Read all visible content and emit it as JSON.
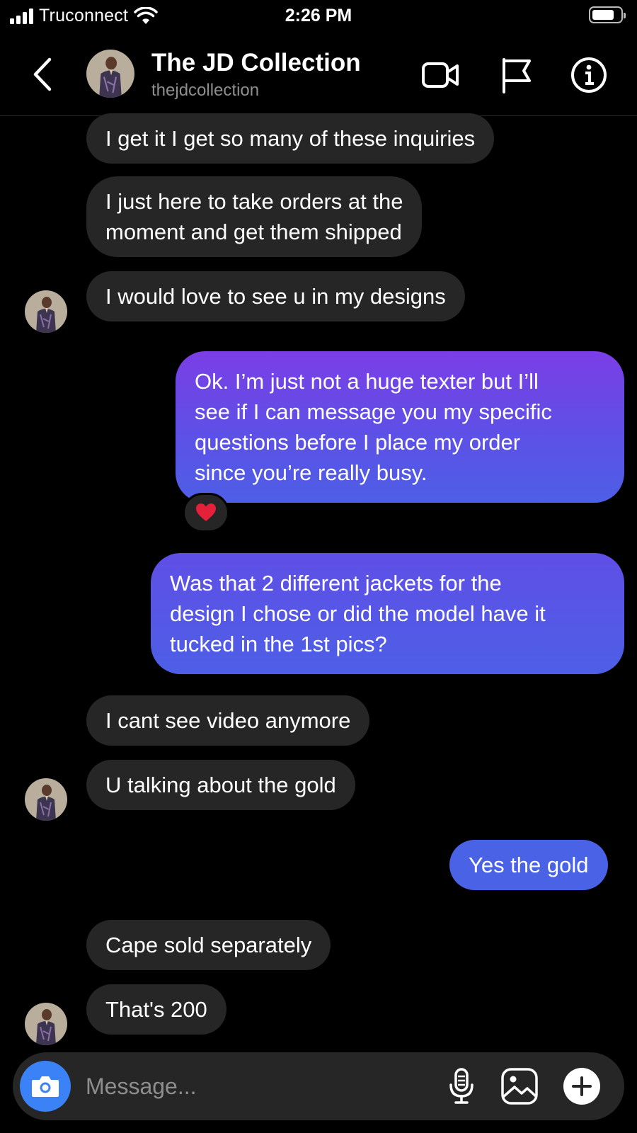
{
  "status_bar": {
    "carrier": "Truconnect",
    "time": "2:26 PM"
  },
  "header": {
    "title": "The JD Collection",
    "username": "thejdcollection",
    "icons": [
      "back-chevron-icon",
      "video-camera-icon",
      "flag-icon",
      "info-icon"
    ]
  },
  "messages": [
    {
      "side": "received",
      "text": "I get it I get so many of these inquiries"
    },
    {
      "side": "received",
      "text_lines": [
        "I just here to take orders at the",
        "moment and get them shipped"
      ]
    },
    {
      "side": "received",
      "text": "I would love to see u in my designs"
    },
    {
      "side": "sent",
      "text_lines": [
        "Ok. I’m just not a huge texter but I’ll",
        "see if I can message you my specific",
        "questions before I place my order",
        "since you’re really busy."
      ],
      "reaction": "❤️"
    },
    {
      "side": "sent",
      "text_lines": [
        "Was that 2 different jackets for the",
        "design I chose or did the model have it",
        "tucked in the 1st pics?"
      ]
    },
    {
      "side": "received",
      "text": "I cant see video anymore"
    },
    {
      "side": "received",
      "text": "U talking about the gold"
    },
    {
      "side": "sent",
      "text": "Yes the gold"
    },
    {
      "side": "received",
      "text": "Cape sold separately"
    },
    {
      "side": "received",
      "text": "That's 200"
    }
  ],
  "composer": {
    "placeholder": "Message...",
    "icons": [
      "camera-icon",
      "microphone-icon",
      "gallery-icon",
      "plus-icon"
    ]
  },
  "colors": {
    "background": "#000000",
    "received_bubble": "#262626",
    "sent_gradient_top": "#7b3ee6",
    "sent_gradient_bottom": "#4d5fe6",
    "camera_button": "#3a82f6",
    "muted_text": "#8e8e8e"
  }
}
